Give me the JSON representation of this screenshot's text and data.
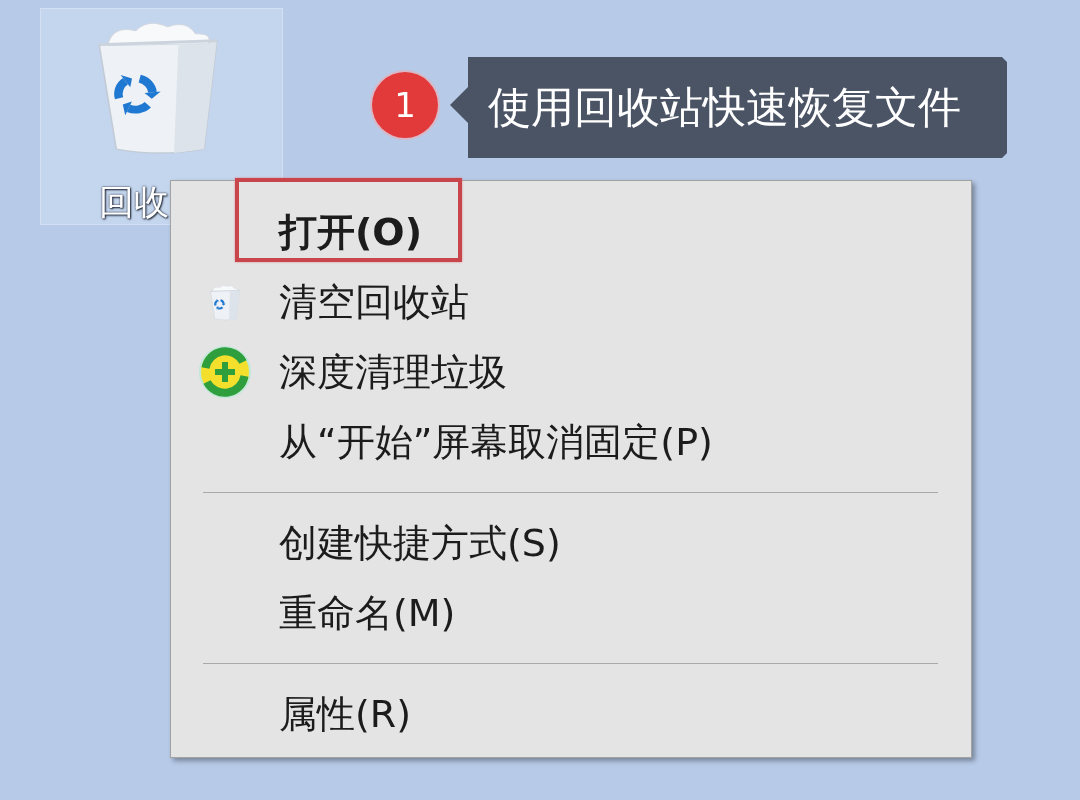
{
  "desktop_icon": {
    "label": "回收",
    "selected": true
  },
  "callout": {
    "number": "1",
    "text": "使用回收站快速恢复文件"
  },
  "context_menu": {
    "groups": [
      {
        "items": [
          {
            "label": "打开(O)",
            "kind": "plain",
            "default": true,
            "highlighted": true
          },
          {
            "label": "清空回收站",
            "kind": "bin",
            "default": false,
            "highlighted": false
          },
          {
            "label": "深度清理垃圾",
            "kind": "cleaner",
            "default": false,
            "highlighted": false
          },
          {
            "label": "从“开始”屏幕取消固定(P)",
            "kind": "plain",
            "default": false,
            "highlighted": false
          }
        ]
      },
      {
        "items": [
          {
            "label": "创建快捷方式(S)",
            "kind": "plain",
            "default": false,
            "highlighted": false
          },
          {
            "label": "重命名(M)",
            "kind": "plain",
            "default": false,
            "highlighted": false
          }
        ]
      },
      {
        "items": [
          {
            "label": "属性(R)",
            "kind": "plain",
            "default": false,
            "highlighted": false
          }
        ]
      }
    ]
  }
}
